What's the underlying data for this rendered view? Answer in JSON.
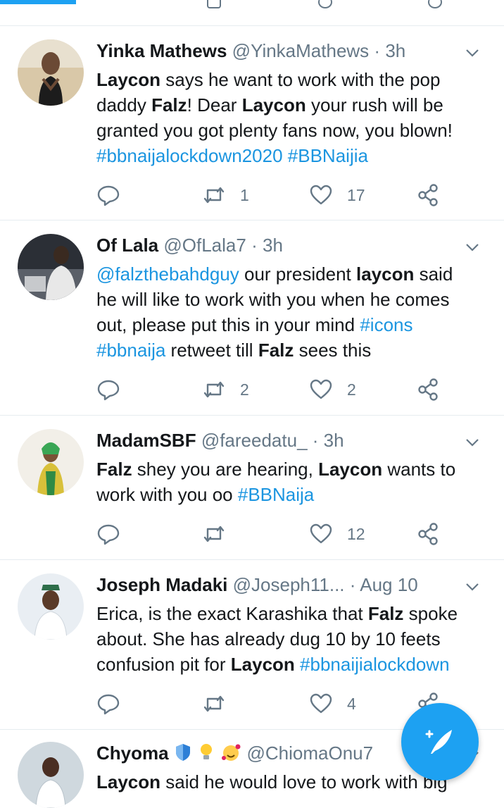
{
  "feed": {
    "tweets": [
      {
        "name": "Yinka Mathews",
        "handle": "@YinkaMathews",
        "time": "3h",
        "lines": [
          [
            {
              "t": "Laycon",
              "s": "b"
            },
            {
              "t": " says he want to work with the pop"
            }
          ],
          [
            {
              "t": "daddy "
            },
            {
              "t": "Falz",
              "s": "b"
            },
            {
              "t": "! Dear "
            },
            {
              "t": "Laycon",
              "s": "b"
            },
            {
              "t": " your rush will be"
            }
          ],
          [
            {
              "t": "granted you got plenty fans now, you blown!"
            }
          ],
          [
            {
              "t": "#bbnaijalockdown2020",
              "s": "l"
            },
            {
              "t": " "
            },
            {
              "t": "#BBNaijia",
              "s": "l"
            }
          ]
        ],
        "replies": "",
        "retweets": "1",
        "likes": "17"
      },
      {
        "name": "Of Lala",
        "handle": "@OfLala7",
        "time": "3h",
        "lines": [
          [
            {
              "t": "@falzthebahdguy",
              "s": "l"
            },
            {
              "t": " our president "
            },
            {
              "t": "laycon",
              "s": "b"
            },
            {
              "t": " said"
            }
          ],
          [
            {
              "t": "he will like to work with you when he comes"
            }
          ],
          [
            {
              "t": "out, please put this in your mind "
            },
            {
              "t": "#icons",
              "s": "l"
            }
          ],
          [
            {
              "t": "#bbnaija",
              "s": "l"
            },
            {
              "t": " retweet till "
            },
            {
              "t": "Falz",
              "s": "b"
            },
            {
              "t": " sees this"
            }
          ]
        ],
        "replies": "",
        "retweets": "2",
        "likes": "2"
      },
      {
        "name": "MadamSBF",
        "handle": "@fareedatu_",
        "time": "3h",
        "lines": [
          [
            {
              "t": "Falz",
              "s": "b"
            },
            {
              "t": " shey you are hearing, "
            },
            {
              "t": "Laycon",
              "s": "b"
            },
            {
              "t": " wants to"
            }
          ],
          [
            {
              "t": "work with you oo "
            },
            {
              "t": "#BBNaija",
              "s": "l"
            }
          ]
        ],
        "replies": "",
        "retweets": "",
        "likes": "12"
      },
      {
        "name": "Joseph Madaki",
        "handle": "@Joseph11...",
        "time": "Aug 10",
        "lines": [
          [
            {
              "t": "Erica, is the exact Karashika that "
            },
            {
              "t": "Falz",
              "s": "b"
            },
            {
              "t": " spoke"
            }
          ],
          [
            {
              "t": "about. She has already dug 10 by 10 feets"
            }
          ],
          [
            {
              "t": "confusion pit for "
            },
            {
              "t": "Laycon",
              "s": "b"
            },
            {
              "t": " "
            },
            {
              "t": "#bbnaijialockdown",
              "s": "l"
            }
          ]
        ],
        "replies": "",
        "retweets": "",
        "likes": "4"
      },
      {
        "name": "Chyoma",
        "handle": "@ChiomaOnu7",
        "time": "",
        "lines": [
          [
            {
              "t": "Laycon",
              "s": "b"
            },
            {
              "t": " said he would love to work with big"
            }
          ]
        ],
        "replies": "",
        "retweets": "",
        "likes": ""
      }
    ]
  },
  "icons": {
    "reply": "reply-icon",
    "retweet": "retweet-icon",
    "like": "heart-icon",
    "share": "share-icon",
    "menu": "chevron-down-icon",
    "compose": "compose-tweet-icon"
  },
  "colors": {
    "accent": "#1da1f2",
    "link": "#1b95e0",
    "secondary_text": "#657786",
    "divider": "#e6ecf0"
  }
}
